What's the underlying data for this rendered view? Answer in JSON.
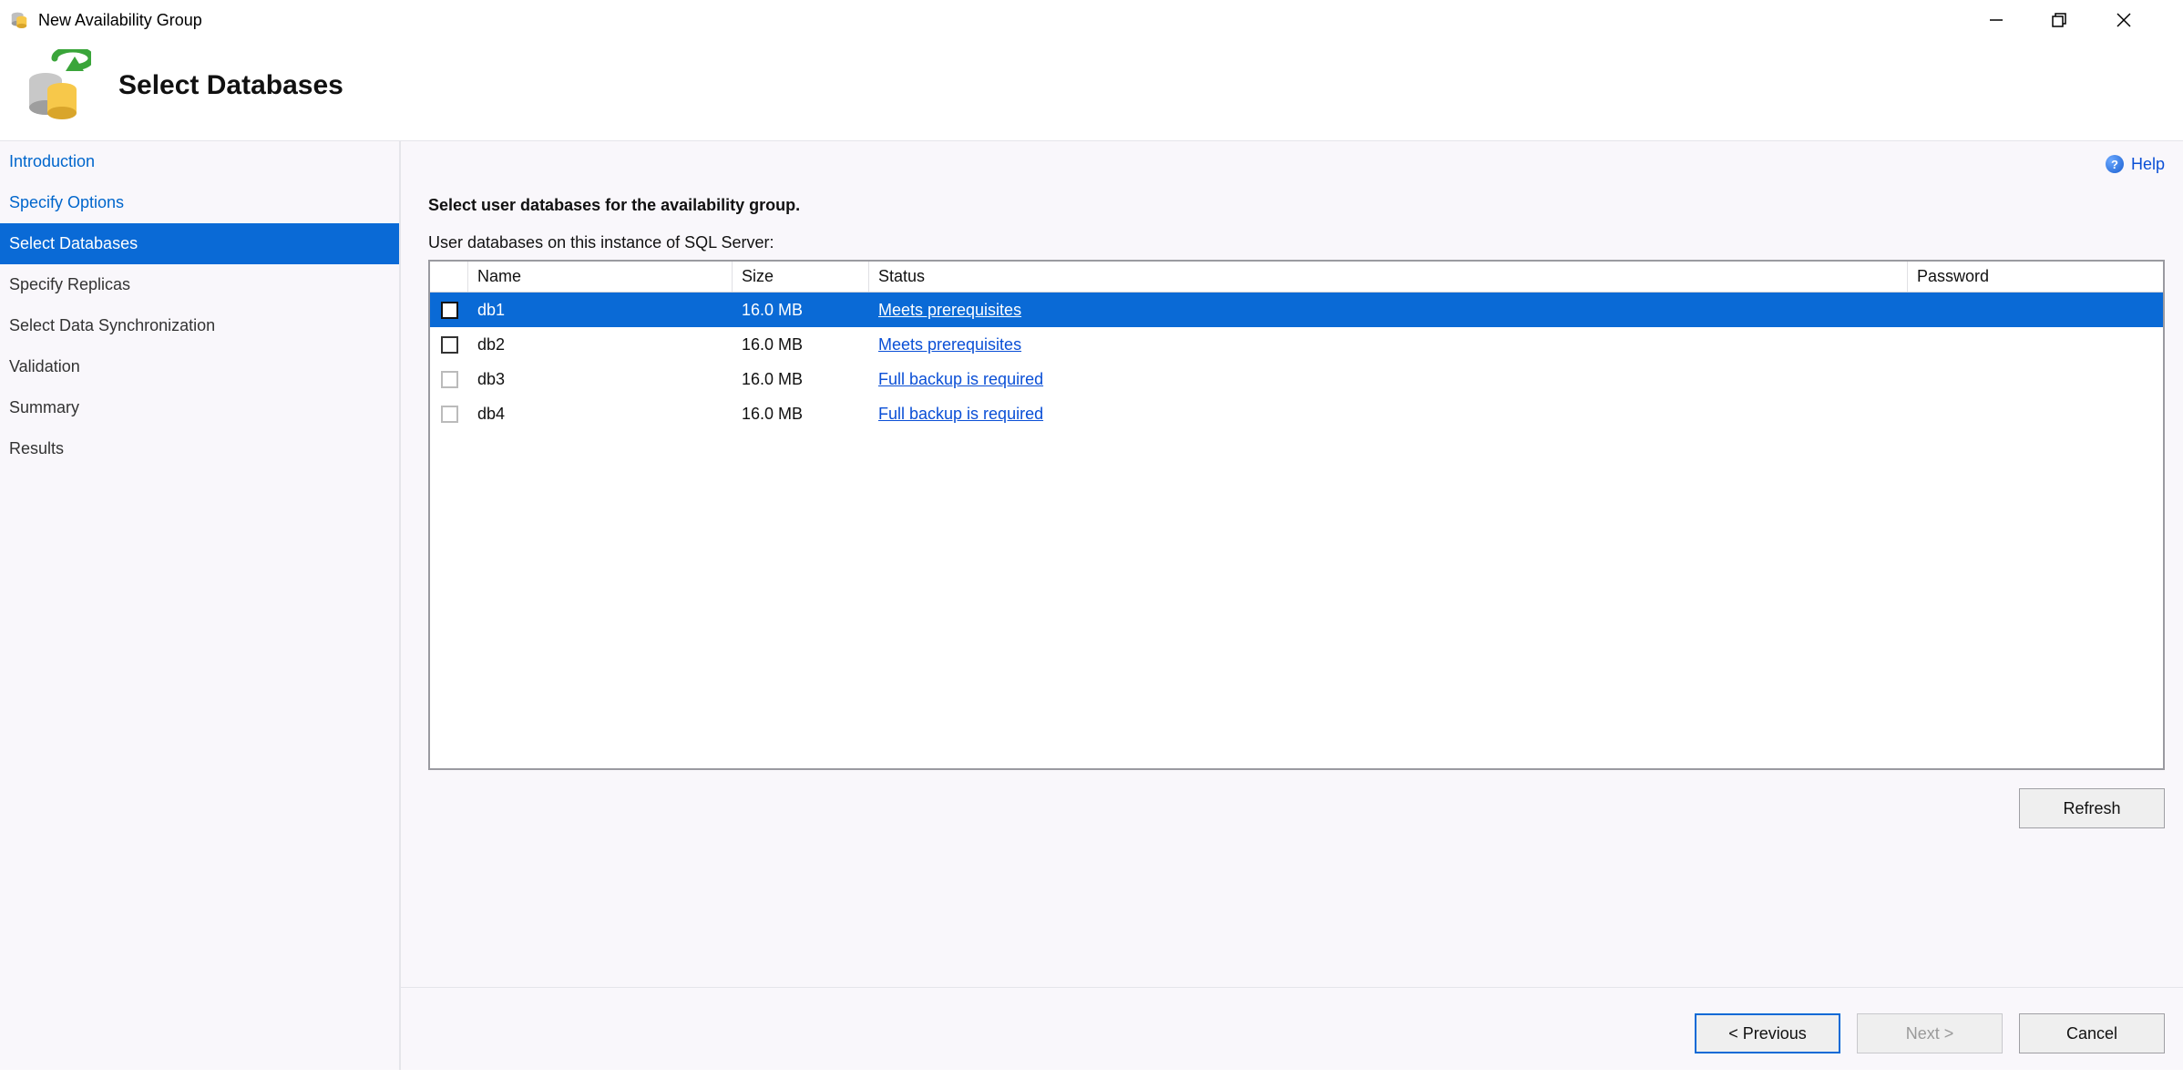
{
  "window": {
    "title": "New Availability Group"
  },
  "header": {
    "page_title": "Select Databases"
  },
  "sidebar": {
    "items": [
      {
        "label": "Introduction",
        "state": "link"
      },
      {
        "label": "Specify Options",
        "state": "link"
      },
      {
        "label": "Select Databases",
        "state": "active"
      },
      {
        "label": "Specify Replicas",
        "state": "normal"
      },
      {
        "label": "Select Data Synchronization",
        "state": "normal"
      },
      {
        "label": "Validation",
        "state": "normal"
      },
      {
        "label": "Summary",
        "state": "normal"
      },
      {
        "label": "Results",
        "state": "normal"
      }
    ]
  },
  "help": {
    "label": "Help"
  },
  "main": {
    "section_title": "Select user databases for the availability group.",
    "subtitle": "User databases on this instance of SQL Server:",
    "columns": {
      "name": "Name",
      "size": "Size",
      "status": "Status",
      "password": "Password"
    },
    "rows": [
      {
        "name": "db1",
        "size": "16.0 MB",
        "status": "Meets prerequisites",
        "selected": true,
        "checkbox_enabled": true
      },
      {
        "name": "db2",
        "size": "16.0 MB",
        "status": "Meets prerequisites",
        "selected": false,
        "checkbox_enabled": true
      },
      {
        "name": "db3",
        "size": "16.0 MB",
        "status": "Full backup is required",
        "selected": false,
        "checkbox_enabled": false
      },
      {
        "name": "db4",
        "size": "16.0 MB",
        "status": "Full backup is required",
        "selected": false,
        "checkbox_enabled": false
      }
    ],
    "buttons": {
      "refresh": "Refresh",
      "previous": "< Previous",
      "next": "Next >",
      "cancel": "Cancel"
    }
  }
}
